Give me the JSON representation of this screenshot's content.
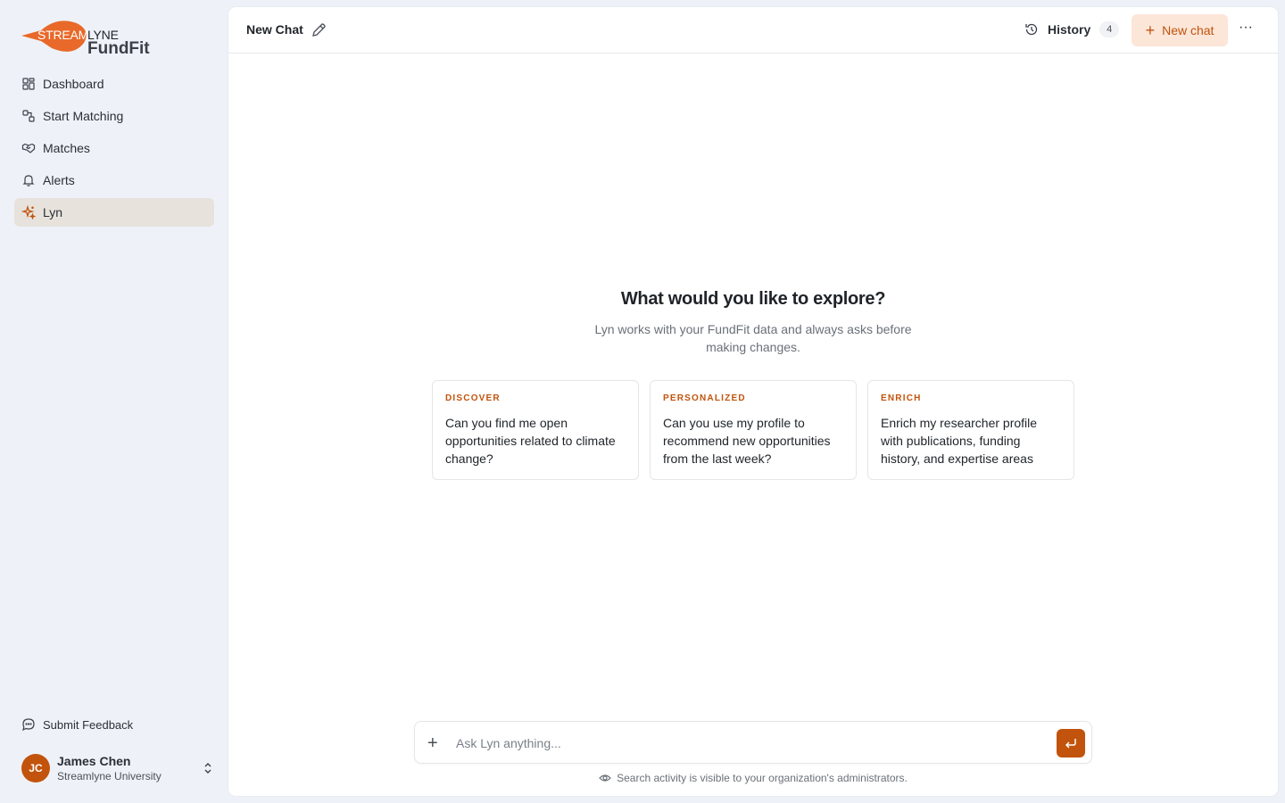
{
  "brand": {
    "word1": "STREAM",
    "word2": "LYNE",
    "word3": "FundFit",
    "accent": "#e8692a"
  },
  "sidebar": {
    "items": [
      {
        "label": "Dashboard",
        "icon": "grid-icon"
      },
      {
        "label": "Start Matching",
        "icon": "matching-icon"
      },
      {
        "label": "Matches",
        "icon": "handshake-icon"
      },
      {
        "label": "Alerts",
        "icon": "bell-icon"
      },
      {
        "label": "Lyn",
        "icon": "sparkle-icon",
        "active": true
      }
    ],
    "feedback_label": "Submit Feedback",
    "user": {
      "initials": "JC",
      "name": "James Chen",
      "org": "Streamlyne University"
    }
  },
  "header": {
    "title": "New Chat",
    "history_label": "History",
    "history_count": "4",
    "new_chat_label": "New chat",
    "more_label": "···"
  },
  "hero": {
    "title": "What would you like to explore?",
    "subtitle": "Lyn works with your FundFit data and always asks before making changes."
  },
  "cards": [
    {
      "tag": "DISCOVER",
      "text": "Can you find me open opportunities related to climate change?"
    },
    {
      "tag": "PERSONALIZED",
      "text": "Can you use my profile to recommend new opportunities from the last week?"
    },
    {
      "tag": "ENRICH",
      "text": "Enrich my researcher profile with publications, funding history, and expertise areas"
    }
  ],
  "composer": {
    "placeholder": "Ask Lyn anything...",
    "value": ""
  },
  "notice": "Search activity is visible to your organization's administrators.",
  "colors": {
    "accent": "#c2530c",
    "accent_light": "#fbe6d8",
    "sidebar_bg": "#eef2f8",
    "active_item_bg": "#e7e2dc"
  }
}
